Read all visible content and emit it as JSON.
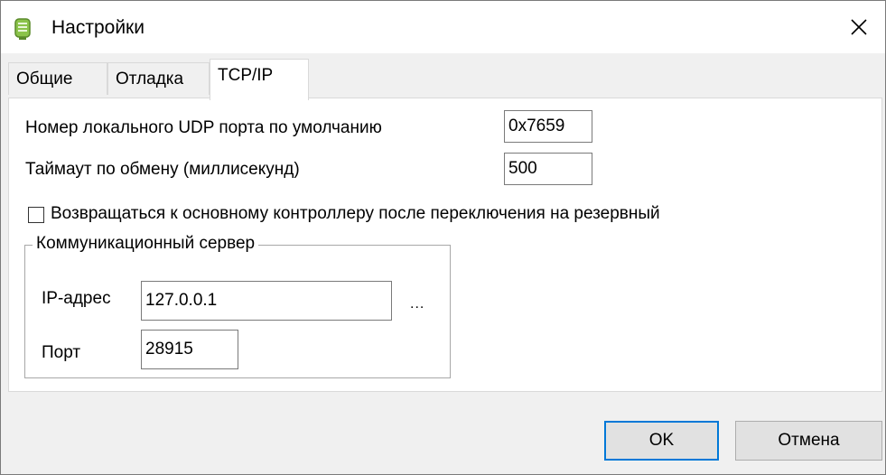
{
  "window": {
    "title": "Настройки",
    "app_icon": "app-icon",
    "close_icon": "close-icon"
  },
  "tabs": [
    {
      "label": "Общие",
      "active": false
    },
    {
      "label": "Отладка",
      "active": false
    },
    {
      "label": "TCP/IP",
      "active": true
    }
  ],
  "tcpip": {
    "udp_port_label": "Номер локального UDP порта по умолчанию",
    "udp_port_value": "0x7659",
    "timeout_label": "Таймаут по обмену (миллисекунд)",
    "timeout_value": "500",
    "fallback_checkbox_label": "Возвращаться к основному контроллеру после переключения на резервный",
    "fallback_checked": false,
    "comm_server": {
      "group_label": "Коммуникационный сервер",
      "ip_label": "IP-адрес",
      "ip_value": "127.0.0.1",
      "browse_label": "...",
      "port_label": "Порт",
      "port_value": "28915"
    }
  },
  "buttons": {
    "ok_label": "OK",
    "cancel_label": "Отмена"
  },
  "colors": {
    "default_button_border": "#0078d7",
    "app_icon_green": "#8bc34a"
  }
}
